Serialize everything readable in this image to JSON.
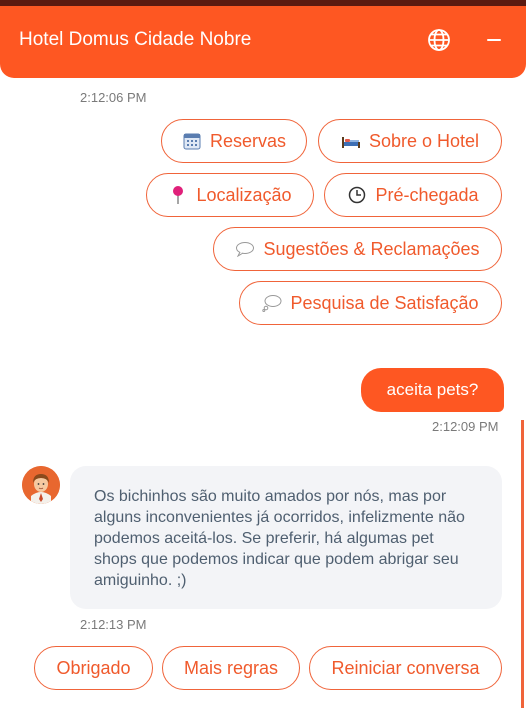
{
  "header": {
    "title": "Hotel Domus Cidade Nobre",
    "globe_icon": "globe-icon",
    "minimize_icon": "minimize-icon",
    "color": "#fe5722"
  },
  "messages": {
    "menu_timestamp": "2:12:06 PM",
    "menu_options": [
      {
        "label": "Reservas",
        "icon": "calendar-icon"
      },
      {
        "label": "Sobre o Hotel",
        "icon": "bed-icon"
      },
      {
        "label": "Localização",
        "icon": "pin-icon"
      },
      {
        "label": "Pré-chegada",
        "icon": "clock-icon"
      },
      {
        "label": "Sugestões & Reclamações",
        "icon": "speech-bubble-icon"
      },
      {
        "label": "Pesquisa de Satisfação",
        "icon": "thought-bubble-icon"
      }
    ],
    "user_message": "aceita pets?",
    "user_timestamp": "2:12:09 PM",
    "bot_message": "Os bichinhos são muito amados por nós, mas por alguns inconvenientes já ocorridos, infelizmente não podemos aceitá-los. Se preferir, há algumas pet shops que podemos indicar que podem abrigar seu amiguinho. ;)",
    "bot_timestamp": "2:12:13 PM"
  },
  "quick_replies": [
    "Obrigado",
    "Mais regras",
    "Reiniciar conversa"
  ],
  "colors": {
    "accent": "#fe5722",
    "chip_text": "#f05a2c",
    "bot_bubble": "#f3f4f7"
  }
}
